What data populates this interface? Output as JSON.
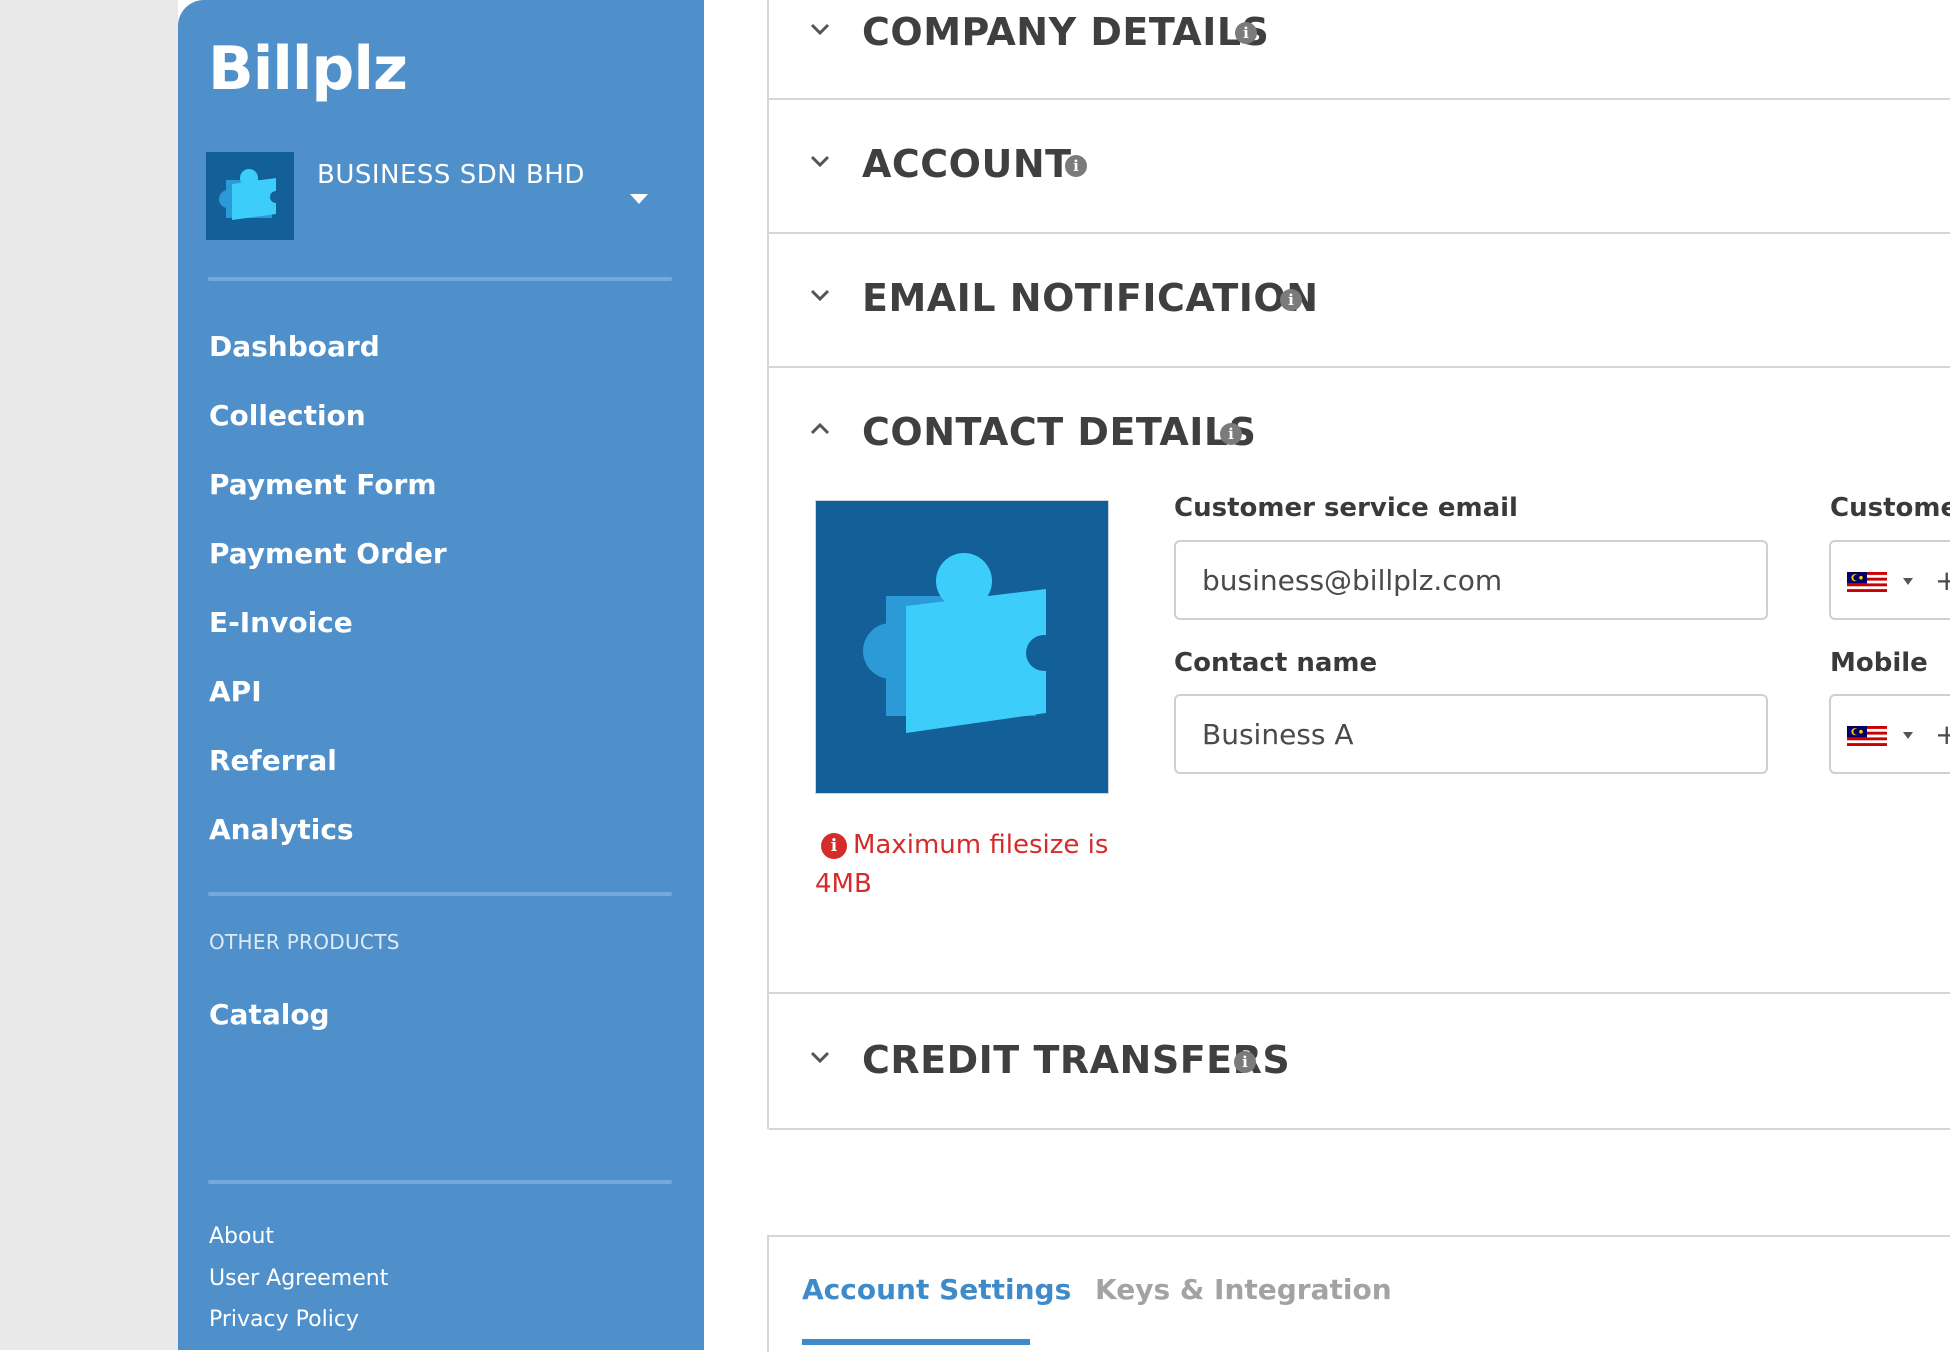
{
  "brand": {
    "name": "Billplz",
    "accent_color": "#4f90cb"
  },
  "org": {
    "name": "BUSINESS SDN BHD"
  },
  "sidebar": {
    "nav": [
      {
        "label": "Dashboard"
      },
      {
        "label": "Collection"
      },
      {
        "label": "Payment Form"
      },
      {
        "label": "Payment Order"
      },
      {
        "label": "E-Invoice"
      },
      {
        "label": "API"
      },
      {
        "label": "Referral"
      },
      {
        "label": "Analytics"
      }
    ],
    "other_products_label": "OTHER PRODUCTS",
    "other_products": [
      {
        "label": "Catalog"
      }
    ],
    "footer": [
      {
        "label": "About"
      },
      {
        "label": "User Agreement"
      },
      {
        "label": "Privacy Policy"
      }
    ]
  },
  "sections": {
    "company_details": {
      "title": "COMPANY DETAILS",
      "expanded": false
    },
    "account": {
      "title": "ACCOUNT",
      "expanded": false
    },
    "email_notification": {
      "title": "EMAIL NOTIFICATION",
      "expanded": false
    },
    "contact_details": {
      "title": "CONTACT DETAILS",
      "expanded": true
    },
    "credit_transfers": {
      "title": "CREDIT TRANSFERS",
      "expanded": false
    }
  },
  "contact": {
    "upload_error": "Maximum filesize is 4MB",
    "cs_email_label": "Customer service email",
    "cs_email_value": "business@billplz.com",
    "contact_name_label": "Contact name",
    "contact_name_value": "Business A",
    "cs_phone_label": "Custome",
    "mobile_label": "Mobile",
    "phone_prefix": "+"
  },
  "tabs": [
    {
      "label": "Account Settings",
      "active": true
    },
    {
      "label": "Keys & Integration",
      "active": false
    }
  ]
}
